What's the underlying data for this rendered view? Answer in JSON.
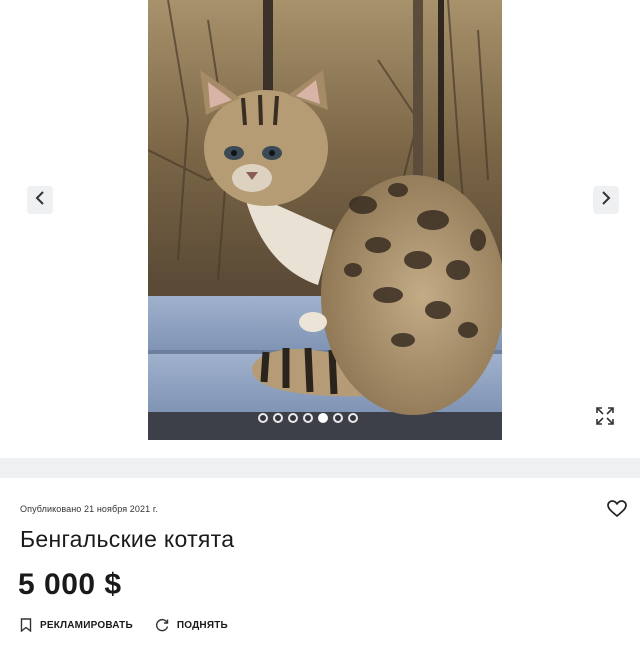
{
  "gallery": {
    "photo_alt": "",
    "slide_count": 7,
    "active_slide": 5,
    "prev_icon": "chevron-left-icon",
    "next_icon": "chevron-right-icon",
    "fullscreen_icon": "expand-icon"
  },
  "listing": {
    "published": "Опубликовано 21 ноября 2021 г.",
    "title": "Бенгальские котята",
    "price": "5 000 $",
    "favorite_icon": "heart-icon"
  },
  "actions": [
    {
      "label": "РЕКЛАМИРОВАТЬ",
      "icon": "bookmark-icon"
    },
    {
      "label": "ПОДНЯТЬ",
      "icon": "refresh-icon"
    }
  ],
  "colors": {
    "background": "#ffffff",
    "divider": "#eef0f2",
    "text": "#1a1a1a"
  }
}
